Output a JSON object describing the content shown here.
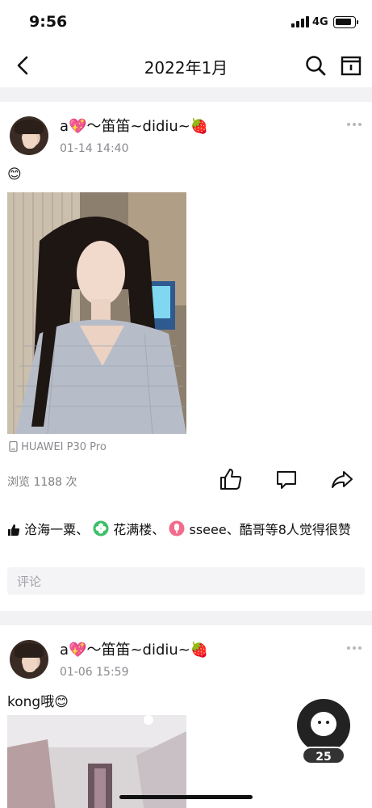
{
  "status_bar": {
    "time": "9:56",
    "network": "4G"
  },
  "nav": {
    "title": "2022年1月",
    "back_icon": "back-arrow-icon",
    "search_icon": "search-icon",
    "calendar_icon": "calendar-icon"
  },
  "posts": [
    {
      "username": "a💖～笛笛~didiu~🍓",
      "timestamp": "01-14 14:40",
      "text": "😊",
      "device": "HUAWEI P30 Pro",
      "views": "浏览 1188 次",
      "likes_text": "沧海一粟、 花满楼、 sseee、酷哥等8人觉得很赞",
      "likes_names": [
        "沧海一粟、",
        "花满楼、",
        "sseee、酷哥等8人觉得很赞"
      ],
      "comment_placeholder": "评论"
    },
    {
      "username": "a💖～笛笛~didiu~🍓",
      "timestamp": "01-06 15:59",
      "text": "kong哦😊"
    }
  ],
  "fab": {
    "count": "25"
  },
  "colors": {
    "gap": "#f2f2f4",
    "secondary_text": "#8a8a8f",
    "fab_bg": "#222222"
  }
}
